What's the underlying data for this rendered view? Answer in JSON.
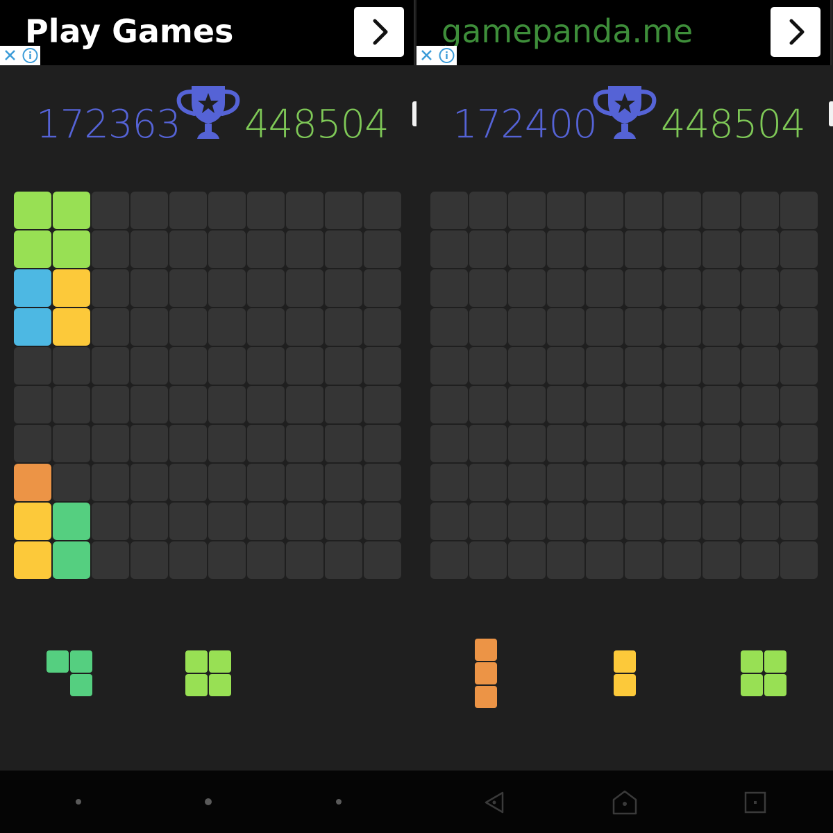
{
  "colors": {
    "background": "#1f1f1f",
    "empty_cell": "#353535",
    "current_score": "#5563d6",
    "best_score": "#7fc957",
    "trophy": "#5563d6",
    "lime": "#98e054",
    "blue": "#4db8e3",
    "yellow": "#fcc93a",
    "orange": "#ec9446",
    "green": "#55cf80"
  },
  "panels": [
    {
      "ad": {
        "text": "Play Games",
        "style": "bold",
        "arrow_icon": "chevron-right-icon",
        "close_icon": "close-icon",
        "info_icon": "info-icon"
      },
      "scores": {
        "current": "172363",
        "best": "448504"
      },
      "trophy_icon": "trophy-star-icon",
      "board": {
        "rows": 10,
        "cols": 10,
        "filled": [
          {
            "row": 0,
            "col": 0,
            "color": "lime"
          },
          {
            "row": 0,
            "col": 1,
            "color": "lime"
          },
          {
            "row": 1,
            "col": 0,
            "color": "lime"
          },
          {
            "row": 1,
            "col": 1,
            "color": "lime"
          },
          {
            "row": 2,
            "col": 0,
            "color": "blue"
          },
          {
            "row": 2,
            "col": 1,
            "color": "yellow"
          },
          {
            "row": 3,
            "col": 0,
            "color": "blue"
          },
          {
            "row": 3,
            "col": 1,
            "color": "yellow"
          },
          {
            "row": 7,
            "col": 0,
            "color": "orange"
          },
          {
            "row": 8,
            "col": 0,
            "color": "yellow"
          },
          {
            "row": 8,
            "col": 1,
            "color": "green"
          },
          {
            "row": 9,
            "col": 0,
            "color": "yellow"
          },
          {
            "row": 9,
            "col": 1,
            "color": "green"
          }
        ]
      },
      "pieces": [
        {
          "name": "corner-piece",
          "color": "green",
          "cells": [
            [
              0,
              0
            ],
            [
              0,
              1
            ],
            [
              1,
              1
            ]
          ]
        },
        {
          "name": "square-piece",
          "color": "lime",
          "cells": [
            [
              0,
              0
            ],
            [
              0,
              1
            ],
            [
              1,
              0
            ],
            [
              1,
              1
            ]
          ]
        }
      ]
    },
    {
      "ad": {
        "text": "gamepanda.me",
        "style": "link",
        "arrow_icon": "chevron-right-icon",
        "close_icon": "close-icon",
        "info_icon": "info-icon"
      },
      "scores": {
        "current": "172400",
        "best": "448504"
      },
      "trophy_icon": "trophy-star-icon",
      "board": {
        "rows": 10,
        "cols": 10,
        "filled": []
      },
      "pieces": [
        {
          "name": "vertical-three-piece",
          "color": "orange",
          "cells": [
            [
              0,
              0
            ],
            [
              1,
              0
            ],
            [
              2,
              0
            ]
          ]
        },
        {
          "name": "vertical-two-piece",
          "color": "yellow",
          "cells": [
            [
              0,
              0
            ],
            [
              1,
              0
            ]
          ]
        },
        {
          "name": "square-piece",
          "color": "lime",
          "cells": [
            [
              0,
              0
            ],
            [
              0,
              1
            ],
            [
              1,
              0
            ],
            [
              1,
              1
            ]
          ]
        }
      ]
    }
  ],
  "navbar": {
    "left_icons": [
      "nav-dot",
      "nav-dot",
      "nav-dot"
    ],
    "right_icons": [
      "back-triangle-icon",
      "home-icon",
      "recents-square-icon"
    ]
  }
}
